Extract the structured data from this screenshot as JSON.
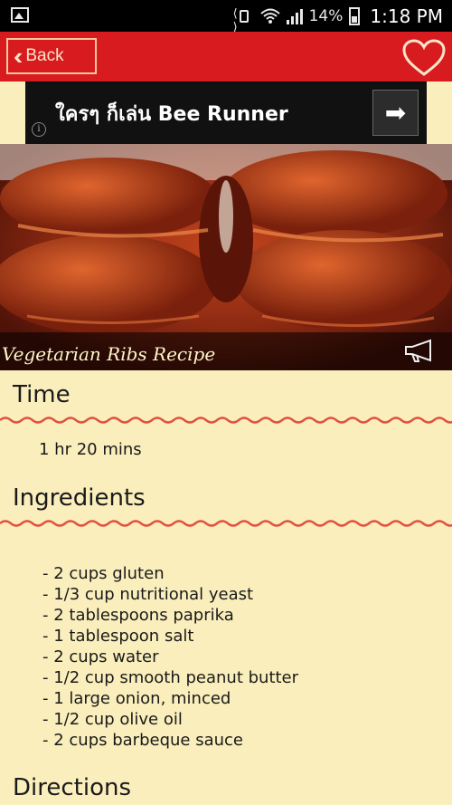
{
  "status_bar": {
    "battery_percent": "14%",
    "time": "1:18 PM"
  },
  "app_bar": {
    "back_label": "Back",
    "back_icon": "double-chevron-left-icon",
    "favorite_icon": "heart-outline-icon"
  },
  "ad": {
    "text": "ใครๆ ก็เล่น Bee Runner",
    "action_icon": "arrow-right-icon",
    "info_icon": "info-icon"
  },
  "recipe": {
    "title": "Vegetarian Ribs Recipe",
    "share_icon": "megaphone-icon"
  },
  "sections": {
    "time_heading": "Time",
    "time_value": "1 hr 20 mins",
    "ingredients_heading": "Ingredients",
    "directions_heading": "Directions"
  },
  "ingredients": [
    "2 cups gluten",
    "1/3 cup nutritional yeast",
    "2 tablespoons paprika",
    "1 tablespoon salt",
    "2 cups water",
    "1/2 cup smooth peanut butter",
    "1 large onion, minced",
    "1/2 cup olive oil",
    "2 cups barbeque sauce"
  ],
  "colors": {
    "app_bar": "#D71B1F",
    "background": "#FAEEBC",
    "wave": "#E0513F"
  }
}
